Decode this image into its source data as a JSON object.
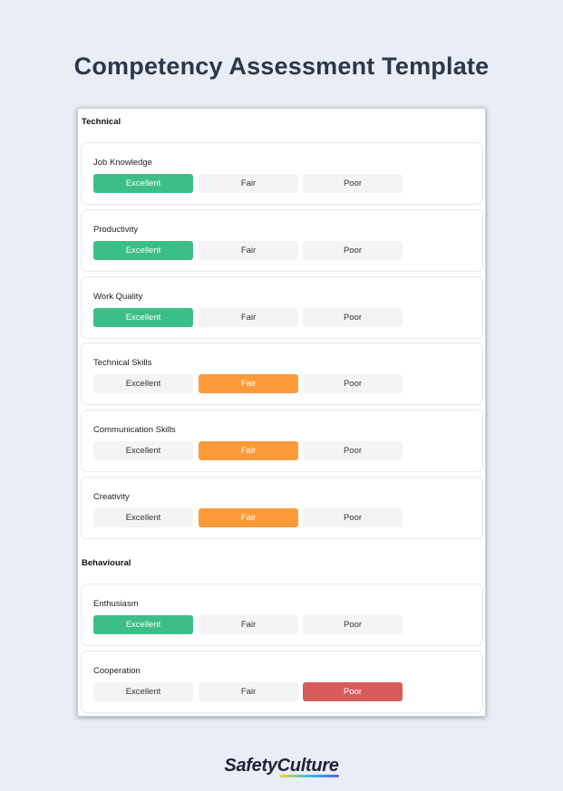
{
  "page": {
    "title": "Competency Assessment Template"
  },
  "options": [
    "Excellent",
    "Fair",
    "Poor"
  ],
  "sections": [
    {
      "title": "Technical",
      "items": [
        {
          "label": "Job Knowledge",
          "selected": "Excellent"
        },
        {
          "label": "Productivity",
          "selected": "Excellent"
        },
        {
          "label": "Work Quality",
          "selected": "Excellent"
        },
        {
          "label": "Technical Skills",
          "selected": "Fair"
        },
        {
          "label": "Communication Skills",
          "selected": "Fair"
        },
        {
          "label": "Creativity",
          "selected": "Fair"
        }
      ]
    },
    {
      "title": "Behavioural",
      "items": [
        {
          "label": "Enthusiasm",
          "selected": "Excellent"
        },
        {
          "label": "Cooperation",
          "selected": "Poor"
        }
      ]
    }
  ],
  "colors": {
    "excellent": "#3cbf86",
    "fair": "#fd9a38",
    "poor": "#d95c5c",
    "unselected": "#f3f4f6",
    "background": "#e9eef6"
  },
  "brand": {
    "part1": "Safety",
    "part2": "Culture"
  }
}
